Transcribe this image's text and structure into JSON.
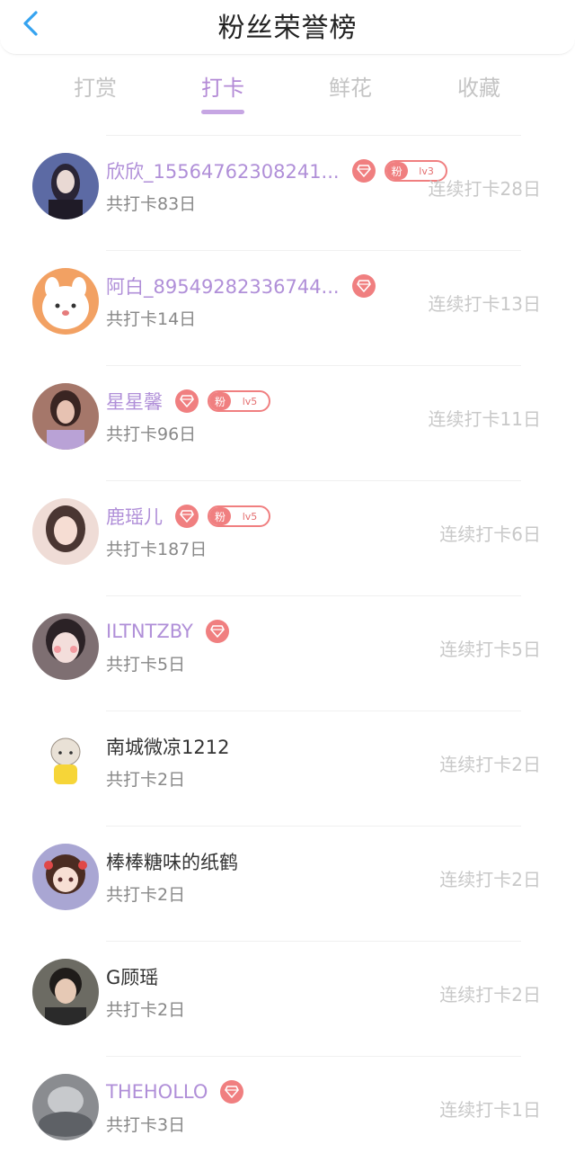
{
  "header": {
    "title": "粉丝荣誉榜"
  },
  "tabs": [
    {
      "label": "打赏",
      "active": false
    },
    {
      "label": "打卡",
      "active": true
    },
    {
      "label": "鲜花",
      "active": false
    },
    {
      "label": "收藏",
      "active": false
    }
  ],
  "colors": {
    "accent": "#b08fd8",
    "badge": "#f07f80",
    "muted": "#c8c8c8"
  },
  "rows": [
    {
      "name": "欣欣_15564762308241...",
      "total": "共打卡83日",
      "streak": "连续打卡28日",
      "diamond": true,
      "fan_badge": {
        "label": "粉",
        "level": "lv3"
      }
    },
    {
      "name": "阿白_89549282336744...",
      "total": "共打卡14日",
      "streak": "连续打卡13日",
      "diamond": true
    },
    {
      "name": "星星馨",
      "total": "共打卡96日",
      "streak": "连续打卡11日",
      "diamond": true,
      "fan_badge": {
        "label": "粉",
        "level": "lv5"
      }
    },
    {
      "name": "鹿瑶儿",
      "total": "共打卡187日",
      "streak": "连续打卡6日",
      "diamond": true,
      "fan_badge": {
        "label": "粉",
        "level": "lv5"
      }
    },
    {
      "name": "ILTNTZBY",
      "total": "共打卡5日",
      "streak": "连续打卡5日",
      "diamond": true
    },
    {
      "name": "南城微凉1212",
      "total": "共打卡2日",
      "streak": "连续打卡2日"
    },
    {
      "name": "棒棒糖味的纸鹤",
      "total": "共打卡2日",
      "streak": "连续打卡2日"
    },
    {
      "name": "G顾瑶",
      "total": "共打卡2日",
      "streak": "连续打卡2日"
    },
    {
      "name": "THEHOLLO",
      "total": "共打卡3日",
      "streak": "连续打卡1日",
      "diamond": true
    }
  ]
}
